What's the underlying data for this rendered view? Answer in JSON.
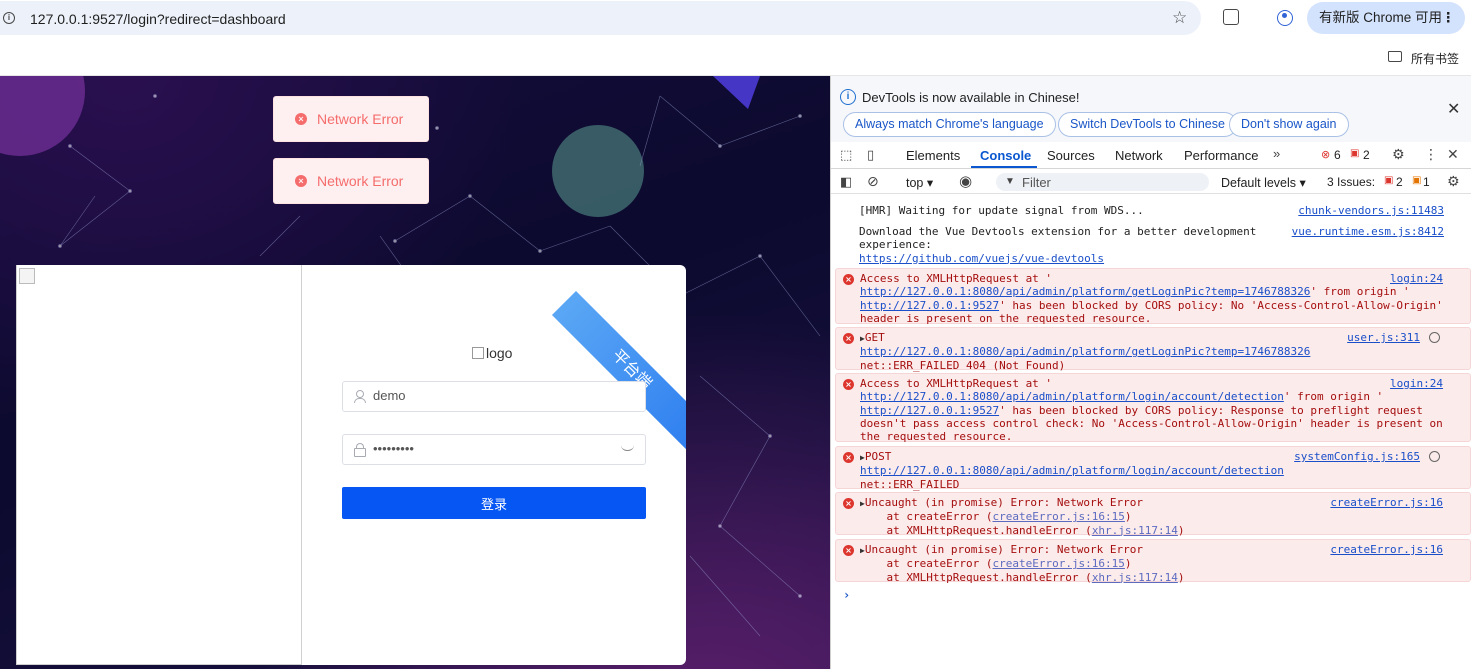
{
  "browser": {
    "url": "127.0.0.1:9527/login?redirect=dashboard",
    "update_button": "有新版 Chrome 可用",
    "bookmarks_label": "所有书签"
  },
  "page": {
    "toasts": [
      "Network Error",
      "Network Error"
    ],
    "ribbon_text": "平台端",
    "logo_alt": "logo",
    "username": "demo",
    "password": "demo12345",
    "login_button": "登录"
  },
  "devtools": {
    "info_text": "DevTools is now available in Chinese!",
    "pills": [
      "Always match Chrome's language",
      "Switch DevTools to Chinese",
      "Don't show again"
    ],
    "tabs": [
      "Elements",
      "Console",
      "Sources",
      "Network",
      "Performance"
    ],
    "error_count": "6",
    "warning_count": "2",
    "context": "top",
    "filter_placeholder": "Filter",
    "levels": "Default levels",
    "issues_label": "3 Issues:",
    "issues_errors": "2",
    "issues_warnings": "1",
    "messages": [
      {
        "type": "log",
        "text": "[HMR] Waiting for update signal from WDS...",
        "source": "chunk-vendors.js:11483"
      },
      {
        "type": "log",
        "lines": [
          "Download the Vue Devtools extension for a better development",
          "experience:"
        ],
        "link": "https://github.com/vuejs/vue-devtools",
        "source": "vue.runtime.esm.js:8412"
      },
      {
        "type": "error",
        "l1": "Access to XMLHttpRequest at '",
        "link1": "http://127.0.0.1:8080/api/admin/platform/getLoginPic?temp=1746788326",
        "l2tail": "' from origin '",
        "link2": "http://127.0.0.1:9527",
        "l3tail": "' has been blocked by CORS policy: No 'Access-Control-Allow-Origin'",
        "l4": "header is present on the requested resource.",
        "source": "login:24"
      },
      {
        "type": "error",
        "method": "GET",
        "link": "http://127.0.0.1:8080/api/admin/platform/getLoginPic?temp=1746788326",
        "status": "net::ERR_FAILED 404 (Not Found)",
        "source": "user.js:311"
      },
      {
        "type": "error",
        "l1": "Access to XMLHttpRequest at '",
        "link1": "http://127.0.0.1:8080/api/admin/platform/login/account/detection",
        "l2tail": "' from origin '",
        "link2": "http://127.0.0.1:9527",
        "l3tail": "' has been blocked by CORS policy: Response to preflight request",
        "l4": "doesn't pass access control check: No 'Access-Control-Allow-Origin' header is present on",
        "l5": "the requested resource.",
        "source": "login:24"
      },
      {
        "type": "error",
        "method": "POST",
        "link": "http://127.0.0.1:8080/api/admin/platform/login/account/detection",
        "status": "net::ERR_FAILED",
        "source": "systemConfig.js:165"
      },
      {
        "type": "error",
        "title": "Uncaught (in promise) Error: Network Error",
        "s1": "at createError (",
        "s1l": "createError.js:16:15",
        "s2": "at XMLHttpRequest.handleError (",
        "s2l": "xhr.js:117:14",
        "source": "createError.js:16"
      },
      {
        "type": "error",
        "title": "Uncaught (in promise) Error: Network Error",
        "s1": "at createError (",
        "s1l": "createError.js:16:15",
        "s2": "at XMLHttpRequest.handleError (",
        "s2l": "xhr.js:117:14",
        "source": "createError.js:16"
      }
    ]
  }
}
